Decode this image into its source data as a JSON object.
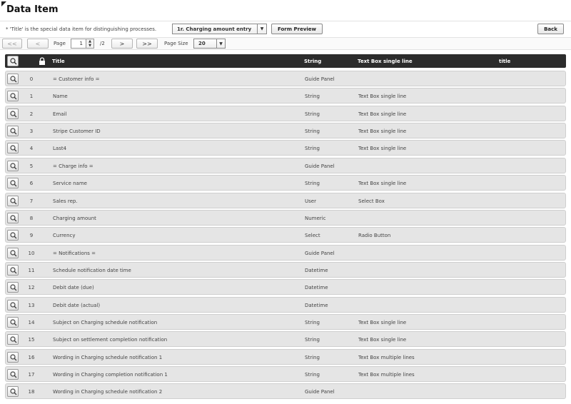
{
  "header": {
    "title": "Data Item"
  },
  "note": "* 'Title' is the special data item for distinguishing processes.",
  "process_select": {
    "value": "1r. Charging amount entry"
  },
  "buttons": {
    "form_preview": "Form Preview",
    "back": "Back"
  },
  "pager": {
    "first": "<<",
    "prev": "<",
    "next": ">",
    "last": ">>",
    "page_label": "Page",
    "page_value": "1",
    "total": "/2",
    "size_label": "Page Size",
    "size_value": "20"
  },
  "table": {
    "columns": {
      "title": "Title",
      "type": "String",
      "form": "Text Box single line",
      "extra": "title"
    },
    "rows": [
      {
        "idx": "0",
        "title": "= Customer info =",
        "type": "Guide Panel",
        "form": ""
      },
      {
        "idx": "1",
        "title": "Name",
        "type": "String",
        "form": "Text Box single line"
      },
      {
        "idx": "2",
        "title": "Email",
        "type": "String",
        "form": "Text Box single line"
      },
      {
        "idx": "3",
        "title": "Stripe Customer ID",
        "type": "String",
        "form": "Text Box single line"
      },
      {
        "idx": "4",
        "title": "Last4",
        "type": "String",
        "form": "Text Box single line"
      },
      {
        "idx": "5",
        "title": "= Charge info =",
        "type": "Guide Panel",
        "form": ""
      },
      {
        "idx": "6",
        "title": "Service name",
        "type": "String",
        "form": "Text Box single line"
      },
      {
        "idx": "7",
        "title": "Sales rep.",
        "type": "User",
        "form": "Select Box"
      },
      {
        "idx": "8",
        "title": "Charging amount",
        "type": "Numeric",
        "form": ""
      },
      {
        "idx": "9",
        "title": "Currency",
        "type": "Select",
        "form": "Radio Button"
      },
      {
        "idx": "10",
        "title": "= Notifications =",
        "type": "Guide Panel",
        "form": ""
      },
      {
        "idx": "11",
        "title": "Schedule notification date time",
        "type": "Datetime",
        "form": ""
      },
      {
        "idx": "12",
        "title": "Debit date (due)",
        "type": "Datetime",
        "form": ""
      },
      {
        "idx": "13",
        "title": "Debit date (actual)",
        "type": "Datetime",
        "form": ""
      },
      {
        "idx": "14",
        "title": "Subject on Charging schedule notification",
        "type": "String",
        "form": "Text Box single line"
      },
      {
        "idx": "15",
        "title": "Subject on settlement completion notification",
        "type": "String",
        "form": "Text Box single line"
      },
      {
        "idx": "16",
        "title": "Wording in Charging schedule notification 1",
        "type": "String",
        "form": "Text Box multiple lines"
      },
      {
        "idx": "17",
        "title": "Wording in Charging completion notification 1",
        "type": "String",
        "form": "Text Box multiple lines"
      },
      {
        "idx": "18",
        "title": "Wording in Charging schedule notification 2",
        "type": "Guide Panel",
        "form": ""
      }
    ]
  }
}
